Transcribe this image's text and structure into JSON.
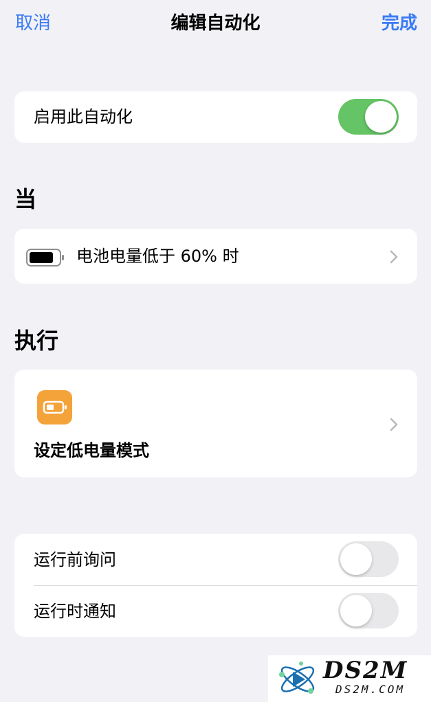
{
  "nav": {
    "cancel": "取消",
    "title": "编辑自动化",
    "done": "完成"
  },
  "enable": {
    "label": "启用此自动化",
    "on": true
  },
  "when": {
    "header": "当",
    "trigger_label": "电池电量低于 60% 时",
    "icon": "battery-icon"
  },
  "do": {
    "header": "执行",
    "action_label": "设定低电量模式",
    "icon": "low-power-battery-icon"
  },
  "options": {
    "ask_before_running": {
      "label": "运行前询问",
      "on": false
    },
    "notify_when_run": {
      "label": "运行时通知",
      "on": false
    }
  },
  "watermark": {
    "brand": "DS2M",
    "url": "DS2M.COM"
  },
  "colors": {
    "accent": "#3a7bf5",
    "toggle_on": "#65c466",
    "toggle_off": "#e8e8ea",
    "action_tile": "#f4a23a",
    "background": "#f1f1f6"
  }
}
